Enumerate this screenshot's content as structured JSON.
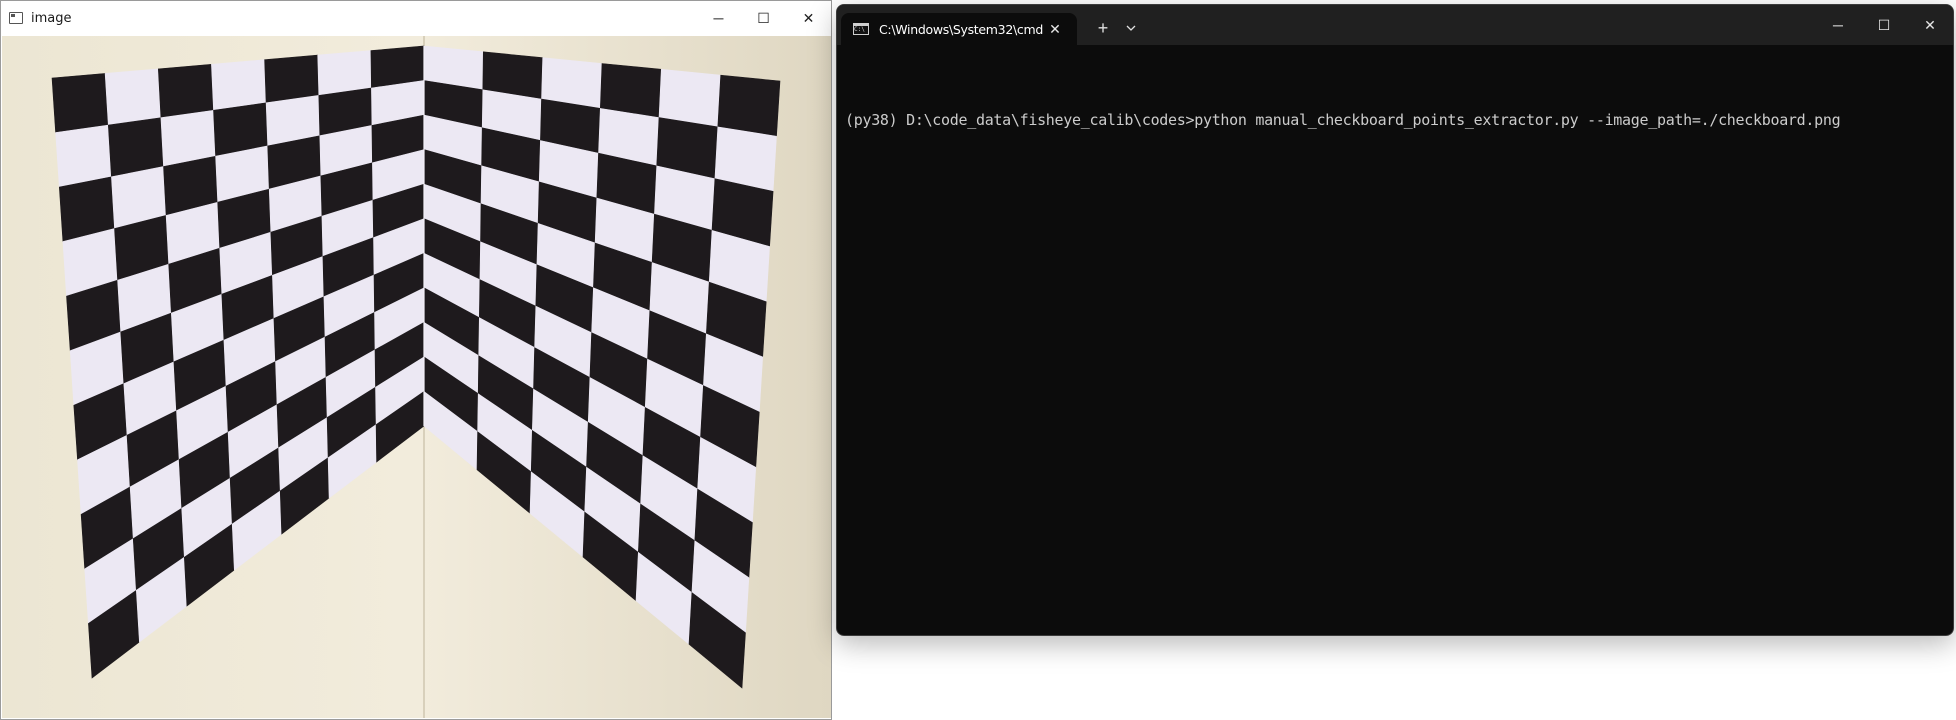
{
  "image_window": {
    "title": "image",
    "controls": {
      "minimize": "─",
      "maximize": "☐",
      "close": "✕"
    }
  },
  "terminal_window": {
    "tab_title": "C:\\Windows\\System32\\cmd",
    "tab_close": "✕",
    "new_tab": "+",
    "dropdown": "⌄",
    "controls": {
      "minimize": "─",
      "maximize": "☐",
      "close": "✕"
    },
    "prompt_line": "(py38) D:\\code_data\\fisheye_calib\\codes>python manual_checkboard_points_extractor.py --image_path=./checkboard.png"
  },
  "colors": {
    "terminal_bg": "#0c0c0c",
    "terminal_titlebar": "#202020",
    "terminal_text": "#cccccc",
    "wall": "#e6dfcc",
    "board_dark": "#1e1a1d",
    "board_light": "#ece8f3"
  },
  "icons": {
    "image_app": "window-app-icon",
    "terminal_tab": "cmd-icon"
  }
}
